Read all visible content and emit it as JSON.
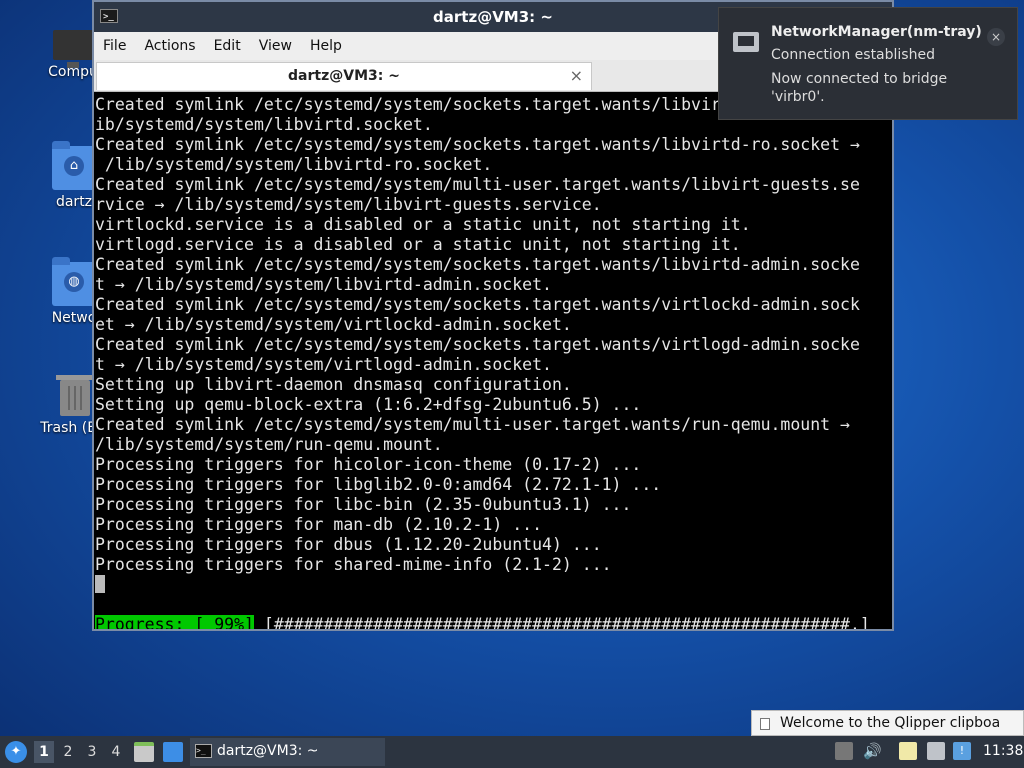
{
  "desktop": {
    "icons": [
      {
        "label": "Compu"
      },
      {
        "label": "dartz"
      },
      {
        "label": "Netwo"
      },
      {
        "label": "Trash (Em"
      }
    ]
  },
  "window": {
    "title": "dartz@VM3: ~",
    "menu": [
      "File",
      "Actions",
      "Edit",
      "View",
      "Help"
    ],
    "tab_title": "dartz@VM3: ~",
    "tab_close": "×"
  },
  "terminal": {
    "lines": [
      "Created symlink /etc/systemd/system/sockets.target.wants/libvir",
      "ib/systemd/system/libvirtd.socket.",
      "Created symlink /etc/systemd/system/sockets.target.wants/libvirtd-ro.socket →",
      " /lib/systemd/system/libvirtd-ro.socket.",
      "Created symlink /etc/systemd/system/multi-user.target.wants/libvirt-guests.se",
      "rvice → /lib/systemd/system/libvirt-guests.service.",
      "virtlockd.service is a disabled or a static unit, not starting it.",
      "virtlogd.service is a disabled or a static unit, not starting it.",
      "Created symlink /etc/systemd/system/sockets.target.wants/libvirtd-admin.socke",
      "t → /lib/systemd/system/libvirtd-admin.socket.",
      "Created symlink /etc/systemd/system/sockets.target.wants/virtlockd-admin.sock",
      "et → /lib/systemd/system/virtlockd-admin.socket.",
      "Created symlink /etc/systemd/system/sockets.target.wants/virtlogd-admin.socke",
      "t → /lib/systemd/system/virtlogd-admin.socket.",
      "Setting up libvirt-daemon dnsmasq configuration.",
      "Setting up qemu-block-extra (1:6.2+dfsg-2ubuntu6.5) ...",
      "Created symlink /etc/systemd/system/multi-user.target.wants/run-qemu.mount →",
      "/lib/systemd/system/run-qemu.mount.",
      "Processing triggers for hicolor-icon-theme (0.17-2) ...",
      "Processing triggers for libglib2.0-0:amd64 (2.72.1-1) ...",
      "Processing triggers for libc-bin (2.35-0ubuntu3.1) ...",
      "Processing triggers for man-db (2.10.2-1) ...",
      "Processing triggers for dbus (1.12.20-2ubuntu4) ...",
      "Processing triggers for shared-mime-info (2.1-2) ..."
    ],
    "progress_label": "Progress: [ 99%]",
    "progress_bar": " [##########################################################.]"
  },
  "notification": {
    "title": "NetworkManager(nm-tray)",
    "line1": "Connection established",
    "line2": "Now connected to bridge 'virbr0'.",
    "close": "×"
  },
  "clipboard_popup": {
    "text": "Welcome to the Qlipper clipboa"
  },
  "taskbar": {
    "desktops": [
      "1",
      "2",
      "3",
      "4"
    ],
    "active_desktop": "1",
    "task_label": "dartz@VM3: ~",
    "clock": "11:38"
  },
  "colors": {
    "progress_green": "#00c800",
    "titlebar": "#2d3746",
    "taskbar": "#2c3440"
  }
}
